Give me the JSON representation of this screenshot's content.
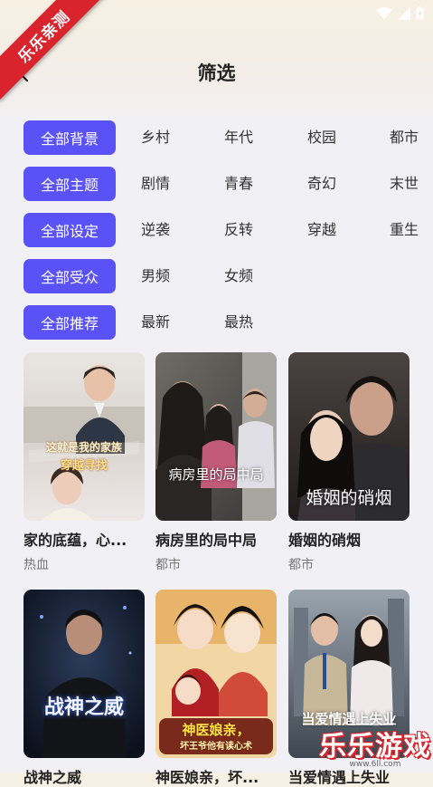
{
  "badge": "乐乐亲测",
  "header": {
    "title": "筛选",
    "back_icon": "chevron-left-icon"
  },
  "filters": [
    {
      "active": "全部背景",
      "options": [
        "乡村",
        "年代",
        "校园",
        "都市"
      ]
    },
    {
      "active": "全部主题",
      "options": [
        "剧情",
        "青春",
        "奇幻",
        "末世"
      ]
    },
    {
      "active": "全部设定",
      "options": [
        "逆袭",
        "反转",
        "穿越",
        "重生"
      ]
    },
    {
      "active": "全部受众",
      "options": [
        "男频",
        "女频"
      ]
    },
    {
      "active": "全部推荐",
      "options": [
        "最新",
        "最热"
      ]
    }
  ],
  "dramas": [
    {
      "title": "家的底蕴，心...",
      "tag": "热血",
      "poster_text": "这就是我的家族",
      "poster_text2": "穿越寻找"
    },
    {
      "title": "病房里的局中局",
      "tag": "都市",
      "poster_text": "病房里的局中局"
    },
    {
      "title": "婚姻的硝烟",
      "tag": "都市",
      "poster_text": "婚姻的硝烟"
    },
    {
      "title": "战神之威",
      "tag": "",
      "poster_text": "战神之威"
    },
    {
      "title": "神医娘亲，坏...",
      "tag": "",
      "poster_text": "神医娘亲，",
      "poster_text2": "坏王爷他有读心术"
    },
    {
      "title": "当爱情遇上失业",
      "tag": "",
      "poster_text": "当爱情遇上失业"
    }
  ],
  "watermark": {
    "main": "乐乐游戏",
    "sub": "www.6ll.com"
  },
  "colors": {
    "accent": "#5a52f6",
    "ribbon": "#d9232d"
  }
}
